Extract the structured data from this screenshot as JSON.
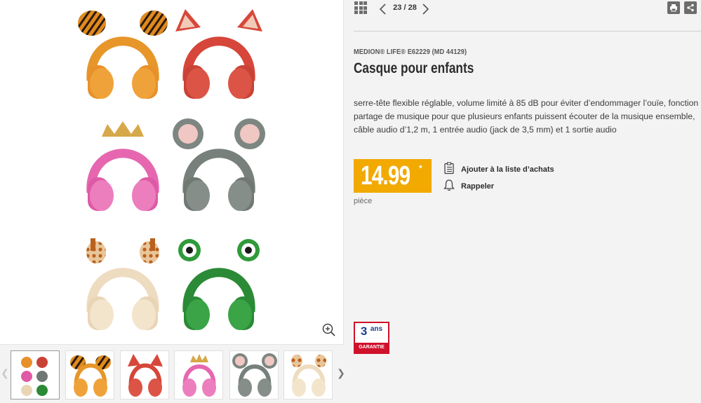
{
  "gallery": {
    "main_alt": "Casque pour enfants",
    "thumbnails_count": 6,
    "active_thumbnail": 0
  },
  "navigation": {
    "counter": "23 / 28"
  },
  "product": {
    "brand_line": "MEDION® LIFE® E62229 (MD 44129)",
    "title": "Casque pour enfants",
    "description": "serre-tête flexible réglable, volume limité à 85 dB pour éviter d’endommager l’ouïe, fonction partage de musique pour que plusieurs enfants puissent écouter de la musique ensemble, câble audio d’1,2 m, 1 entrée audio (jack de 3,5 mm) et 1 sortie audio",
    "price": "14.99",
    "price_footnote": "*",
    "unit": "pièce",
    "actions": {
      "wishlist": "Ajouter à la liste d’achats",
      "remind": "Rappeler"
    },
    "warranty": {
      "years": "3",
      "unit": "ans",
      "band": "GARANTIE"
    }
  },
  "colors": {
    "price_bg": "#f2a900",
    "warranty_red": "#d0112b",
    "warranty_blue": "#1b3f8f"
  },
  "icons": {
    "grid": "grid-icon",
    "prev": "chevron-left-icon",
    "next": "chevron-right-icon",
    "print": "printer-icon",
    "share": "share-icon",
    "zoom": "zoom-in-icon",
    "wishlist": "clipboard-list-icon",
    "remind": "bell-icon"
  }
}
